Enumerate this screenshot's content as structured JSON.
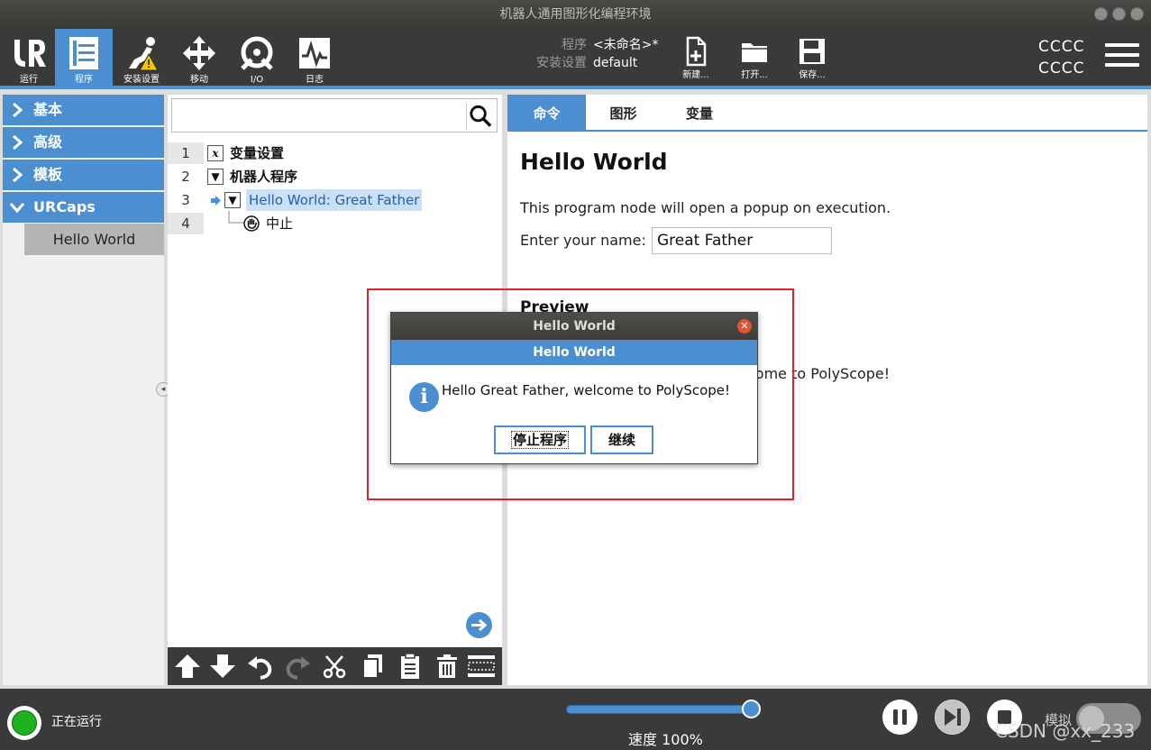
{
  "window": {
    "title": "机器人通用图形化编程环境"
  },
  "toolbar": {
    "buttons": [
      {
        "label": "运行",
        "icon": "ur-logo-icon"
      },
      {
        "label": "程序",
        "icon": "program-tree-icon"
      },
      {
        "label": "安装设置",
        "icon": "installation-warning-icon"
      },
      {
        "label": "移动",
        "icon": "move-arrows-icon"
      },
      {
        "label": "I/O",
        "icon": "io-icon"
      },
      {
        "label": "日志",
        "icon": "log-graph-icon"
      }
    ],
    "active_index": 1,
    "program_label": "程序",
    "program_value": "<未命名>*",
    "installation_label": "安装设置",
    "installation_value": "default",
    "new_label": "新建...",
    "open_label": "打开...",
    "save_label": "保存...",
    "user_line1": "CCCC",
    "user_line2": "CCCC"
  },
  "leftnav": {
    "items": [
      {
        "label": "基本",
        "expanded": false
      },
      {
        "label": "高级",
        "expanded": false
      },
      {
        "label": "模板",
        "expanded": false
      },
      {
        "label": "URCaps",
        "expanded": true
      }
    ],
    "sub_item": "Hello World"
  },
  "tree": {
    "search_placeholder": "",
    "rows": [
      {
        "num": "1",
        "icon": "x-variable-icon",
        "box": "𝑥",
        "label": "变量设置"
      },
      {
        "num": "2",
        "icon": "collapse-triangle-icon",
        "box": "▼",
        "label": "机器人程序"
      },
      {
        "num": "3",
        "icon": "collapse-triangle-icon",
        "box": "▼",
        "label": "Hello World: Great Father",
        "selected": true
      },
      {
        "num": "4",
        "icon": "halt-hand-icon",
        "box": "",
        "label": "中止"
      }
    ]
  },
  "tabs": [
    "命令",
    "图形",
    "变量"
  ],
  "node": {
    "title": "Hello World",
    "description": "This program node will open a popup on execution.",
    "name_label": "Enter your name:",
    "name_value": "Great Father",
    "preview_label": "Preview",
    "preview_text": "come to PolyScope!"
  },
  "dialog": {
    "window_title": "Hello World",
    "header": "Hello World",
    "message": "Hello Great Father, welcome to PolyScope!",
    "stop_button": "停止程序",
    "continue_button": "继续"
  },
  "bottom": {
    "status": "正在运行",
    "speed_text": "速度 100%",
    "speed_percent": 100,
    "sim_label": "模拟",
    "sim_on": false,
    "watermark": "CSDN @xx_233"
  },
  "colors": {
    "accent": "#4b8fd1",
    "toolbar_bg": "#3a3a3a",
    "run_green": "#1fb21f",
    "annotation_red": "#e8202a"
  }
}
